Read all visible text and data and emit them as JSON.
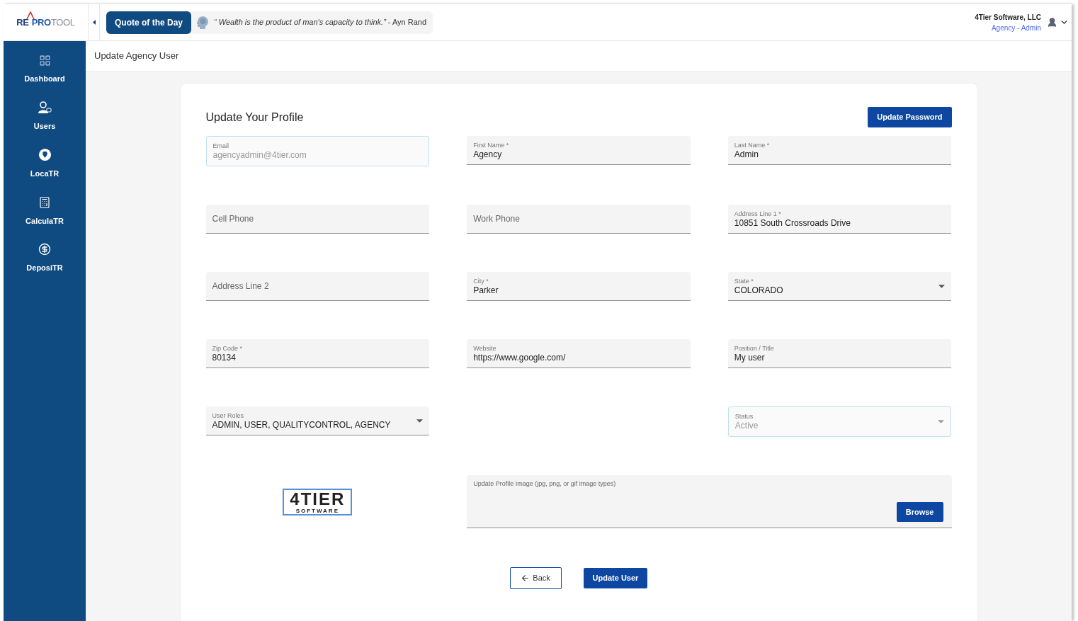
{
  "logo": {
    "parts": [
      "RE",
      "PRO",
      "TOOL"
    ]
  },
  "quote": {
    "label": "Quote of the Day",
    "text": "*“ Wealth is the product of man's capacity to think.”* - Ayn Rand"
  },
  "account": {
    "company": "4Tier Software, LLC",
    "role": "Agency - Admin"
  },
  "sidebar": {
    "items": [
      {
        "label": "Dashboard"
      },
      {
        "label": "Users"
      },
      {
        "label": "LocaTR"
      },
      {
        "label": "CalculaTR"
      },
      {
        "label": "DeposiTR"
      }
    ]
  },
  "breadcrumb": "Update Agency User",
  "form": {
    "title": "Update Your Profile",
    "password_button": "Update Password",
    "rows": [
      [
        {
          "kind": "text",
          "label": "Email",
          "value": "agencyadmin@4tier.com",
          "disabled": true
        },
        {
          "kind": "text",
          "label": "First Name *",
          "value": "Agency",
          "disabled": false
        },
        {
          "kind": "text",
          "label": "Last Name *",
          "value": "Admin",
          "disabled": false
        }
      ],
      [
        {
          "kind": "text",
          "placeholder": "Cell Phone",
          "disabled": false
        },
        {
          "kind": "text",
          "placeholder": "Work Phone",
          "disabled": false
        },
        {
          "kind": "text",
          "label": "Address Line 1 *",
          "value": "10851 South Crossroads Drive",
          "disabled": false
        }
      ],
      [
        {
          "kind": "text",
          "placeholder": "Address Line 2",
          "disabled": false
        },
        {
          "kind": "text",
          "label": "City *",
          "value": "Parker",
          "disabled": false
        },
        {
          "kind": "select",
          "label": "State *",
          "value": "COLORADO",
          "disabled": false
        }
      ],
      [
        {
          "kind": "text",
          "label": "Zip Code *",
          "value": "80134",
          "disabled": false
        },
        {
          "kind": "text",
          "label": "Website",
          "value": "https://www.google.com/",
          "disabled": false
        },
        {
          "kind": "text",
          "label": "Position / Title",
          "value": "My user",
          "disabled": false
        }
      ],
      [
        {
          "kind": "select",
          "label": "User Roles",
          "value": "ADMIN, USER, QUALITYCONTROL, AGENCY",
          "disabled": false
        },
        null,
        {
          "kind": "select",
          "label": "Status",
          "value": "Active",
          "disabled": true
        }
      ]
    ],
    "company_logo": {
      "name": "4TIER",
      "tagline": "SOFTWARE"
    },
    "upload": {
      "label": "Update Profile Image (jpg, png, or gif image types)",
      "button": "Browse"
    },
    "back_button": "Back",
    "submit_button": "Update User"
  }
}
